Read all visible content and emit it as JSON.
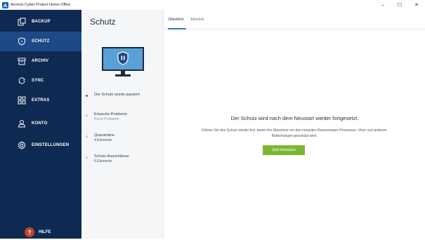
{
  "window": {
    "title": "Acronis Cyber Protect Home Office",
    "controls": {
      "minimize": "–",
      "maximize": "☐",
      "close": "✕"
    }
  },
  "sidebar": {
    "items": [
      {
        "label": "BACKUP",
        "icon": "backup-icon"
      },
      {
        "label": "SCHUTZ",
        "icon": "shield-icon",
        "active": true
      },
      {
        "label": "ARCHIV",
        "icon": "archive-icon"
      },
      {
        "label": "SYNC",
        "icon": "sync-icon"
      },
      {
        "label": "EXTRAS",
        "icon": "tools-grid-icon"
      },
      {
        "label": "KONTO",
        "icon": "user-icon"
      },
      {
        "label": "EINSTELLUNGEN",
        "icon": "gear-icon"
      }
    ],
    "help": {
      "label": "HILFE",
      "icon_glyph": "?"
    }
  },
  "middle": {
    "title": "Schutz",
    "status": "Der Schutz wurde pausiert",
    "rows": [
      {
        "title": "Erkannte Probleme",
        "sub": "Keine Probleme"
      },
      {
        "title": "Quarantäne",
        "sub": "4 Elemente"
      },
      {
        "title": "Schutz-Ausschlüsse",
        "sub": "5 Elemente"
      }
    ]
  },
  "main": {
    "tabs": [
      {
        "label": "Überblick",
        "active": true
      },
      {
        "label": "Aktivität",
        "active": false
      }
    ],
    "message_title": "Der Schutz wird nach dem Neustart wieder fortgesetzt.",
    "message_body": "Führen Sie den Schutz wieder fort, damit Ihre Maschine vor den neuesten Ransomware-Prozessen, Viren und anderen Bedrohungen geschützt wird.",
    "resume_button": "Jetzt fortsetzen"
  },
  "colors": {
    "sidebar_bg": "#0e2a52",
    "sidebar_active": "#1d4a86",
    "accent_blue": "#2a7ad5",
    "resume_green": "#7cb82f",
    "status_blue": "#2a6fc9"
  }
}
